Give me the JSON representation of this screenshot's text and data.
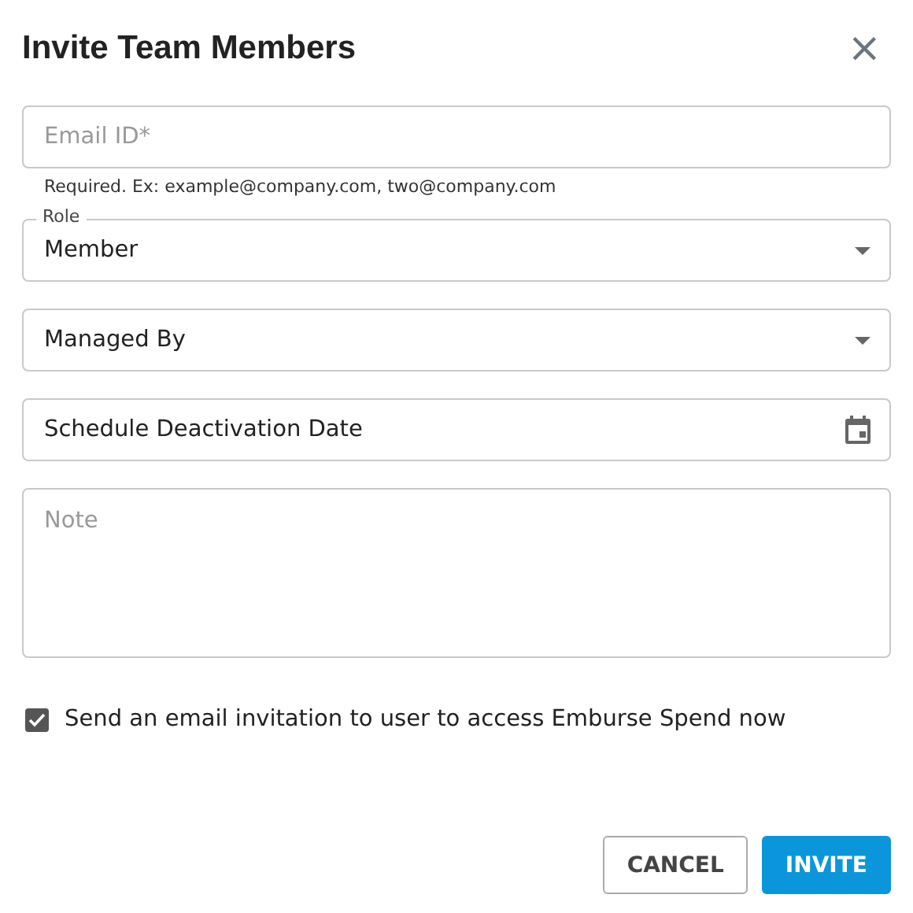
{
  "dialog": {
    "title": "Invite Team Members",
    "close": "×"
  },
  "fields": [
    {
      "kind": "text",
      "placeholder": "Email ID*",
      "helper": "Required. Ex: example@company.com, two@company.com"
    },
    {
      "kind": "select",
      "label": "Role",
      "value": "Member"
    },
    {
      "kind": "select",
      "value": "Managed By"
    },
    {
      "kind": "date",
      "value": "Schedule Deactivation Date"
    },
    {
      "kind": "textarea",
      "placeholder": "Note"
    }
  ],
  "invite_email": {
    "label": "Send an email invitation to user to access Emburse Spend now",
    "checked": true
  },
  "buttons": [
    {
      "kind": "secondary",
      "label": "CANCEL"
    },
    {
      "kind": "primary",
      "label": "INVITE"
    }
  ]
}
